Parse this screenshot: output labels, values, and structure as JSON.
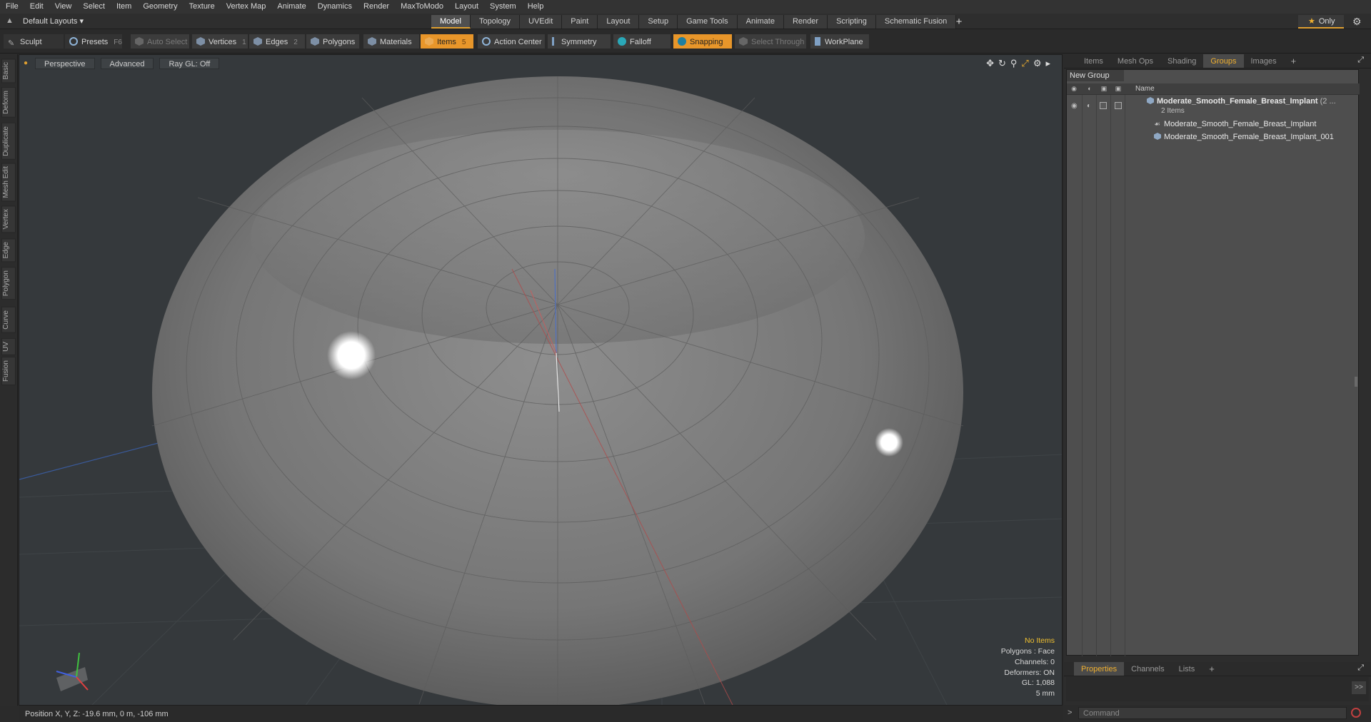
{
  "menu": [
    "File",
    "Edit",
    "View",
    "Select",
    "Item",
    "Geometry",
    "Texture",
    "Vertex Map",
    "Animate",
    "Dynamics",
    "Render",
    "MaxToModo",
    "Layout",
    "System",
    "Help"
  ],
  "layout_dropdown": "Default Layouts ▾",
  "mode_tabs": [
    "Model",
    "Topology",
    "UVEdit",
    "Paint",
    "Layout",
    "Setup",
    "Game Tools",
    "Animate",
    "Render",
    "Scripting",
    "Schematic Fusion"
  ],
  "active_mode_tab": "Model",
  "only_label": "Only",
  "toolbar": {
    "sculpt": "Sculpt",
    "presets": "Presets",
    "presets_key": "F6",
    "auto_select": "Auto Select",
    "vertices": "Vertices",
    "vertices_count": "1",
    "edges": "Edges",
    "edges_count": "2",
    "polygons": "Polygons",
    "materials": "Materials",
    "items": "Items",
    "items_count": "5",
    "action_center": "Action Center",
    "symmetry": "Symmetry",
    "falloff": "Falloff",
    "snapping": "Snapping",
    "select_through": "Select Through",
    "workplane": "WorkPlane"
  },
  "left_tabs": [
    "Basic",
    "Deform",
    "Duplicate",
    "Mesh Edit",
    "Vertex",
    "Edge",
    "Polygon",
    "Curve",
    "UV",
    "Fusion"
  ],
  "viewport": {
    "view_mode": "Perspective",
    "shading": "Advanced",
    "raygl": "Ray GL: Off",
    "info": {
      "status": "No Items",
      "polygons": "Polygons : Face",
      "channels": "Channels: 0",
      "deformers": "Deformers: ON",
      "gl": "GL: 1,088",
      "scale": "5 mm"
    }
  },
  "status_bar": "Position X, Y, Z:   -19.6 mm, 0 m, -106 mm",
  "right_panel": {
    "tabs": [
      "Items",
      "Mesh Ops",
      "Shading",
      "Groups",
      "Images"
    ],
    "active_tab": "Groups",
    "new_group": "New Group",
    "column_name": "Name",
    "group": {
      "name": "Moderate_Smooth_Female_Breast_Implant",
      "suffix": "(2 ...",
      "count": "2 Items",
      "children": [
        "Moderate_Smooth_Female_Breast_Implant",
        "Moderate_Smooth_Female_Breast_Implant_001"
      ]
    },
    "bottom_tabs": [
      "Properties",
      "Channels",
      "Lists"
    ],
    "active_bottom_tab": "Properties",
    "props_button": ">>",
    "command_placeholder": "Command"
  },
  "colors": {
    "accent": "#e8962a",
    "active_tab_text": "#f0b030",
    "viewport_bg": "#35393c",
    "status_highlight": "#f0c030"
  }
}
